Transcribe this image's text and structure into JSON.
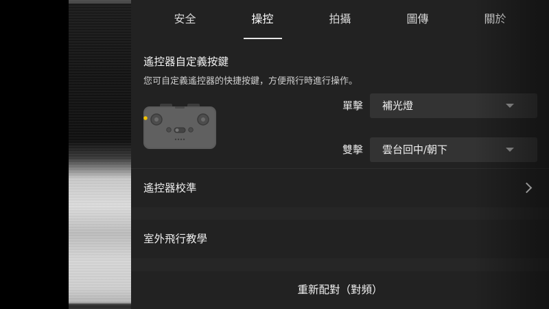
{
  "tabs": [
    {
      "label": "安全",
      "active": false
    },
    {
      "label": "操控",
      "active": true
    },
    {
      "label": "拍攝",
      "active": false
    },
    {
      "label": "圖傳",
      "active": false
    },
    {
      "label": "關於",
      "active": false
    }
  ],
  "custom_buttons": {
    "title": "遙控器自定義按鍵",
    "description": "您可自定義遙控器的快捷按鍵，方便飛行時進行操作。",
    "single_click": {
      "label": "單擊",
      "value": "補光燈"
    },
    "double_click": {
      "label": "雙擊",
      "value": "雲台回中/朝下"
    }
  },
  "calibration": {
    "label": "遙控器校準"
  },
  "outdoor_tutorial": {
    "label": "室外飛行教學"
  },
  "pairing": {
    "label": "重新配對（對頻）"
  },
  "colors": {
    "panel_background": "#222222",
    "dropdown_background": "#333333",
    "indicator_yellow": "#f2c200"
  },
  "icons": {
    "remote": "remote-controller-icon",
    "caret": "caret-down-icon",
    "chevron": "chevron-right-icon"
  }
}
